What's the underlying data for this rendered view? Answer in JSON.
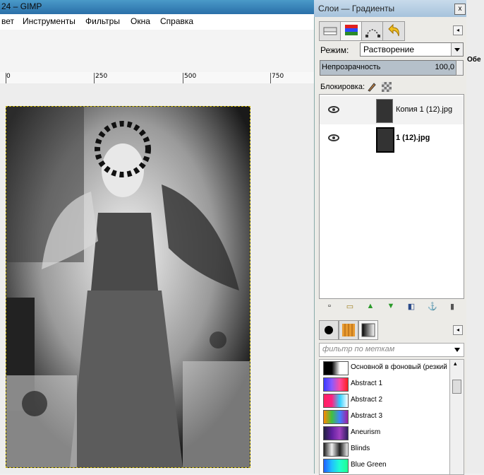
{
  "window": {
    "title": "24 – GIMP"
  },
  "menu": [
    "вет",
    "Инструменты",
    "Фильтры",
    "Окна",
    "Справка"
  ],
  "ruler": {
    "marks": [
      "0",
      "250",
      "500",
      "750"
    ]
  },
  "dock": {
    "title": "Слои — Градиенты",
    "close": "x",
    "mode_label": "Режим:",
    "mode_value": "Растворение",
    "opacity_label": "Непрозрачность",
    "opacity_value": "100,0",
    "lock_label": "Блокировка:",
    "layers": [
      {
        "name": "Копия 1 (12).jpg"
      },
      {
        "name": "1 (12).jpg"
      }
    ],
    "filter_placeholder": "фильтр по меткам",
    "gradients": [
      {
        "name": "Основной в фоновый (резкий",
        "colors": [
          "#000000",
          "#000000",
          "#ffffff",
          "#ffffff"
        ]
      },
      {
        "name": "Abstract 1",
        "colors": [
          "#3a3aff",
          "#8a5aff",
          "#ff4aa0",
          "#ff2020"
        ]
      },
      {
        "name": "Abstract 2",
        "colors": [
          "#ff2060",
          "#ff2080",
          "#30d0ff",
          "#ffffff"
        ]
      },
      {
        "name": "Abstract 3",
        "colors": [
          "#ff8800",
          "#40c040",
          "#4080ff",
          "#a020a0"
        ]
      },
      {
        "name": "Aneurism",
        "colors": [
          "#202040",
          "#6020a0",
          "#a040c0",
          "#302060"
        ]
      },
      {
        "name": "Blinds",
        "colors": [
          "#202020",
          "#f0f0f0",
          "#202020",
          "#f0f0f0"
        ]
      },
      {
        "name": "Blue Green",
        "colors": [
          "#2060ff",
          "#20c0ff",
          "#20ffd0",
          "#20ff90"
        ]
      }
    ]
  },
  "right_strip_text": "Обе"
}
